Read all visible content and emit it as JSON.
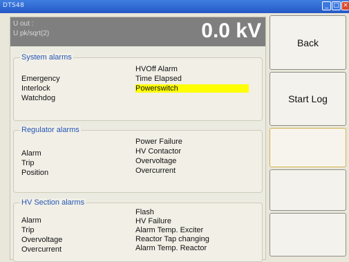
{
  "window": {
    "title": "DTS48"
  },
  "readout": {
    "label1": "U out :",
    "label2": "U pk/sqrt(2)",
    "value": "0.0 kV"
  },
  "system_alarms": {
    "title": "System alarms",
    "left": [
      "Emergency",
      "Interlock",
      "Watchdog"
    ],
    "right": [
      "HVOff Alarm",
      "Time Elapsed",
      "Powerswitch"
    ],
    "highlighted": "Powerswitch",
    "highlight_color": "#ffff00"
  },
  "regulator_alarms": {
    "title": "Regulator alarms",
    "left": [
      "Alarm",
      "Trip",
      "Position"
    ],
    "right": [
      "Power Failure",
      "HV Contactor",
      "Overvoltage",
      "Overcurrent"
    ]
  },
  "hv_section_alarms": {
    "title": "HV Section alarms",
    "left": [
      "Alarm",
      "Trip",
      "Overvoltage",
      "Overcurrent"
    ],
    "right": [
      "Flash",
      "HV Failure",
      "Alarm Temp. Exciter",
      "Reactor Tap changing",
      "Alarm Temp. Reactor"
    ]
  },
  "buttons": {
    "back": "Back",
    "start_log": "Start Log",
    "b3": "",
    "b4": "",
    "b5": ""
  }
}
